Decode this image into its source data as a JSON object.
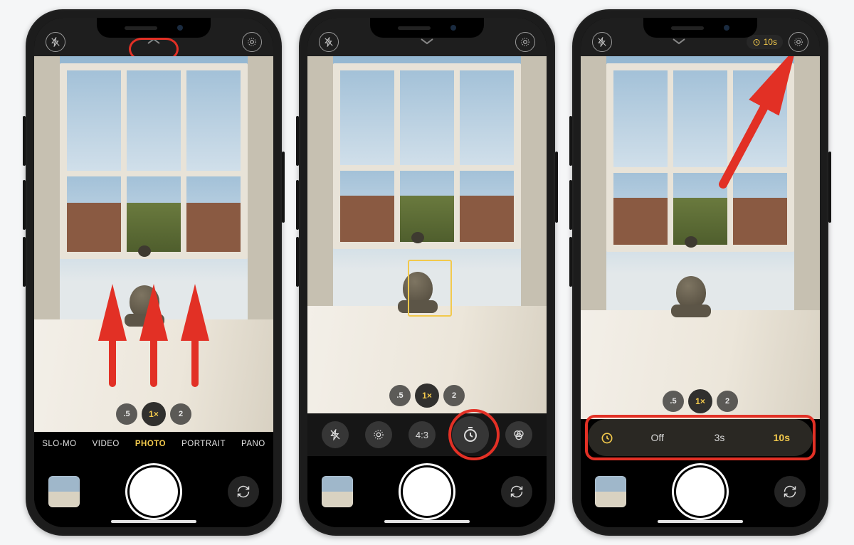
{
  "timer_chip": "10s",
  "zoom": {
    "a": ".5",
    "b": "1×",
    "c": "2"
  },
  "modes": [
    "SLO-MO",
    "VIDEO",
    "PHOTO",
    "PORTRAIT",
    "PANO"
  ],
  "selected_mode_index": 2,
  "toolbar_aspect": "4:3",
  "timer_options": {
    "off": "Off",
    "s3": "3s",
    "s10": "10s"
  },
  "timer_selected": "10s"
}
